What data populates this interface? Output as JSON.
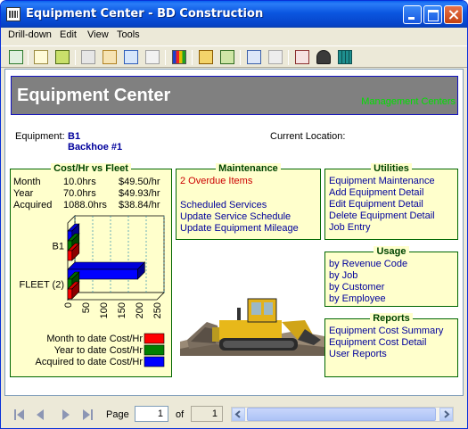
{
  "window": {
    "title": "Equipment Center - BD Construction"
  },
  "menu": [
    "Drill-down",
    "Edit",
    "View",
    "Tools"
  ],
  "toolbar": {
    "icons": [
      "refresh-icon",
      "document-icon",
      "print-icon",
      "find-icon",
      "filter-icon",
      "internet-explorer-icon",
      "notes-icon",
      "bar-chart-icon",
      "export-icon",
      "spreadsheet-icon",
      "arrow-list-icon",
      "copy-icon",
      "home-icon",
      "hat-icon",
      "calculator-icon"
    ]
  },
  "header": {
    "title": "Equipment Center",
    "link": "Management Centers"
  },
  "equipment": {
    "label": "Equipment:",
    "code": "B1",
    "name": "Backhoe #1"
  },
  "location": {
    "label": "Current Location:"
  },
  "cost_panel": {
    "title": "Cost/Hr vs Fleet",
    "rows": [
      {
        "label": "Month",
        "hours": "10.0hrs",
        "rate": "$49.50/hr"
      },
      {
        "label": "Year",
        "hours": "70.0hrs",
        "rate": "$49.93/hr"
      },
      {
        "label": "Acquired",
        "hours": "1088.0hrs",
        "rate": "$38.84/hr"
      }
    ]
  },
  "chart_data": {
    "type": "bar",
    "orientation": "horizontal",
    "three_d": true,
    "categories": [
      "B1",
      "FLEET (2)"
    ],
    "x_ticks": [
      "0",
      "50",
      "100",
      "150",
      "200",
      "250"
    ],
    "xlim": [
      0,
      250
    ],
    "grid": true,
    "legend_position": "bottom",
    "series": [
      {
        "name": "Month to date Cost/Hr",
        "color": "#FF0000",
        "values": [
          12,
          12
        ]
      },
      {
        "name": "Year to date Cost/Hr",
        "color": "#008000",
        "values": [
          12,
          12
        ]
      },
      {
        "name": "Acquired to date Cost/Hr",
        "color": "#0000FF",
        "values": [
          12,
          196
        ]
      }
    ]
  },
  "maintenance": {
    "title": "Maintenance",
    "overdue": "2 Overdue Items",
    "links": [
      "Scheduled Services",
      "Update Service Schedule",
      "Update Equipment Mileage"
    ]
  },
  "utilities": {
    "title": "Utilities",
    "links": [
      "Equipment Maintenance",
      "Add Equipment Detail",
      "Edit Equipment Detail",
      "Delete Equipment Detail",
      "Job Entry"
    ]
  },
  "usage": {
    "title": "Usage",
    "links": [
      "by Revenue Code",
      "by Job",
      "by Customer",
      "by Employee"
    ]
  },
  "reports": {
    "title": "Reports",
    "links": [
      "Equipment Cost Summary",
      "Equipment Cost Detail",
      "User Reports"
    ]
  },
  "pager": {
    "page_label": "Page",
    "page_value": "1",
    "of_label": "of",
    "total": "1"
  }
}
